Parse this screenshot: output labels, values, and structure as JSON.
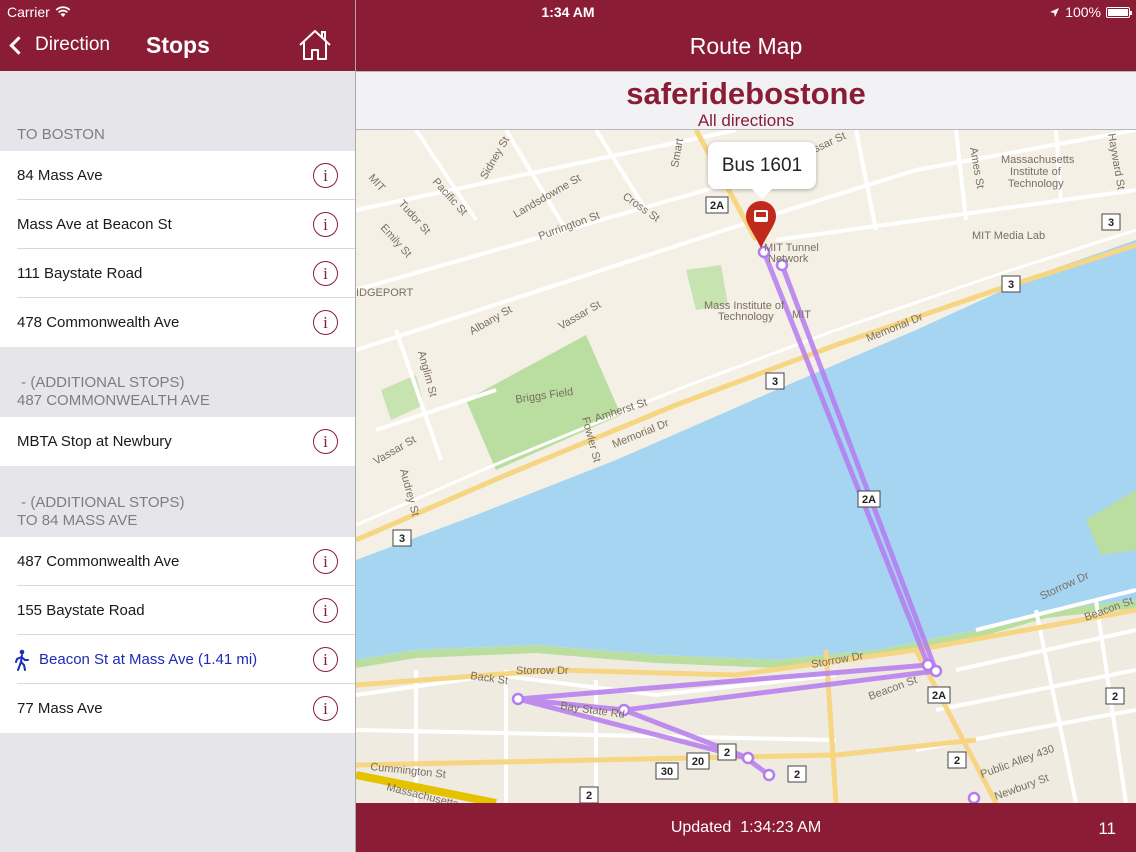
{
  "status": {
    "carrier": "Carrier",
    "time": "1:34 AM",
    "battery": "100%"
  },
  "left": {
    "back_label": "Direction",
    "title": "Stops",
    "sections": [
      {
        "header": "TO BOSTON",
        "rows": [
          "84 Mass Ave",
          "Mass Ave at Beacon St",
          "111 Baystate Road",
          "478 Commonwealth Ave"
        ]
      },
      {
        "header_line1": " - (ADDITIONAL STOPS)",
        "header_line2": "487 COMMONWEALTH AVE",
        "rows": [
          "MBTA Stop at Newbury"
        ]
      },
      {
        "header_line1": " - (ADDITIONAL STOPS)",
        "header_line2": "TO 84 MASS AVE",
        "rows": [
          "487 Commonwealth Ave",
          "155 Baystate Road",
          "Beacon St at Mass Ave (1.41 mi)",
          "77 Mass Ave"
        ]
      }
    ],
    "info_glyph": "i"
  },
  "right": {
    "title": "Route Map",
    "brand_name": "saferidebostone",
    "brand_sub": "All  directions",
    "callout": "Bus 1601",
    "updated": "Updated  1:34:23 AM",
    "count": "11"
  },
  "map_labels": {
    "mass_inst": "Massachusetts",
    "mass_inst2": "Institute of",
    "mass_inst3": "Technology",
    "mit_media_lab": "MIT Media Lab",
    "mit_tunnel": "MIT Tunnel",
    "mit_tunnel2": "Network",
    "mit_campus": "Mass Institute of",
    "mit_campus2": "Technology",
    "mit": "MIT",
    "bridgeport": "IDGEPORT",
    "briggs": "Briggs Field",
    "memorial1": "Memorial Dr",
    "memorial2": "Memorial Dr",
    "albany": "Albany St",
    "vassar1": "Vassar St",
    "vassar2": "Vassar St",
    "vassar3": "Vassar St",
    "amherst": "Amherst St",
    "fowler": "Fowler St",
    "audrey": "Audrey St",
    "anglim": "Anglim St",
    "sidney": "Sidney St",
    "pacific": "Pacific St",
    "tudor": "Tudor St",
    "emily": "Emily St",
    "landsdowne": "Landsdowne St",
    "purrington": "Purrington St",
    "cross": "Cross St",
    "smart": "Smart",
    "ames": "Ames St",
    "hayward": "Hayward St",
    "storrow1": "Storrow Dr",
    "storrow2": "Storrow Dr",
    "storrow3": "Storrow Dr",
    "beacon1": "Beacon St",
    "beacon2": "Beacon St",
    "back": "Back St",
    "baystate": "Bay State Rd",
    "cummington": "Cummington St",
    "massachusetts": "Massachusetts",
    "public_alley": "Public Alley 430",
    "newbury": "Newbury St",
    "s3": "3",
    "s2a": "2A",
    "s2": "2",
    "s20": "20",
    "s30": "30"
  },
  "colors": {
    "brand": "#8b1c35",
    "route": "#b57cf0",
    "water": "#a6d5f2",
    "park": "#b9dea0",
    "land": "#f5f0e6"
  }
}
